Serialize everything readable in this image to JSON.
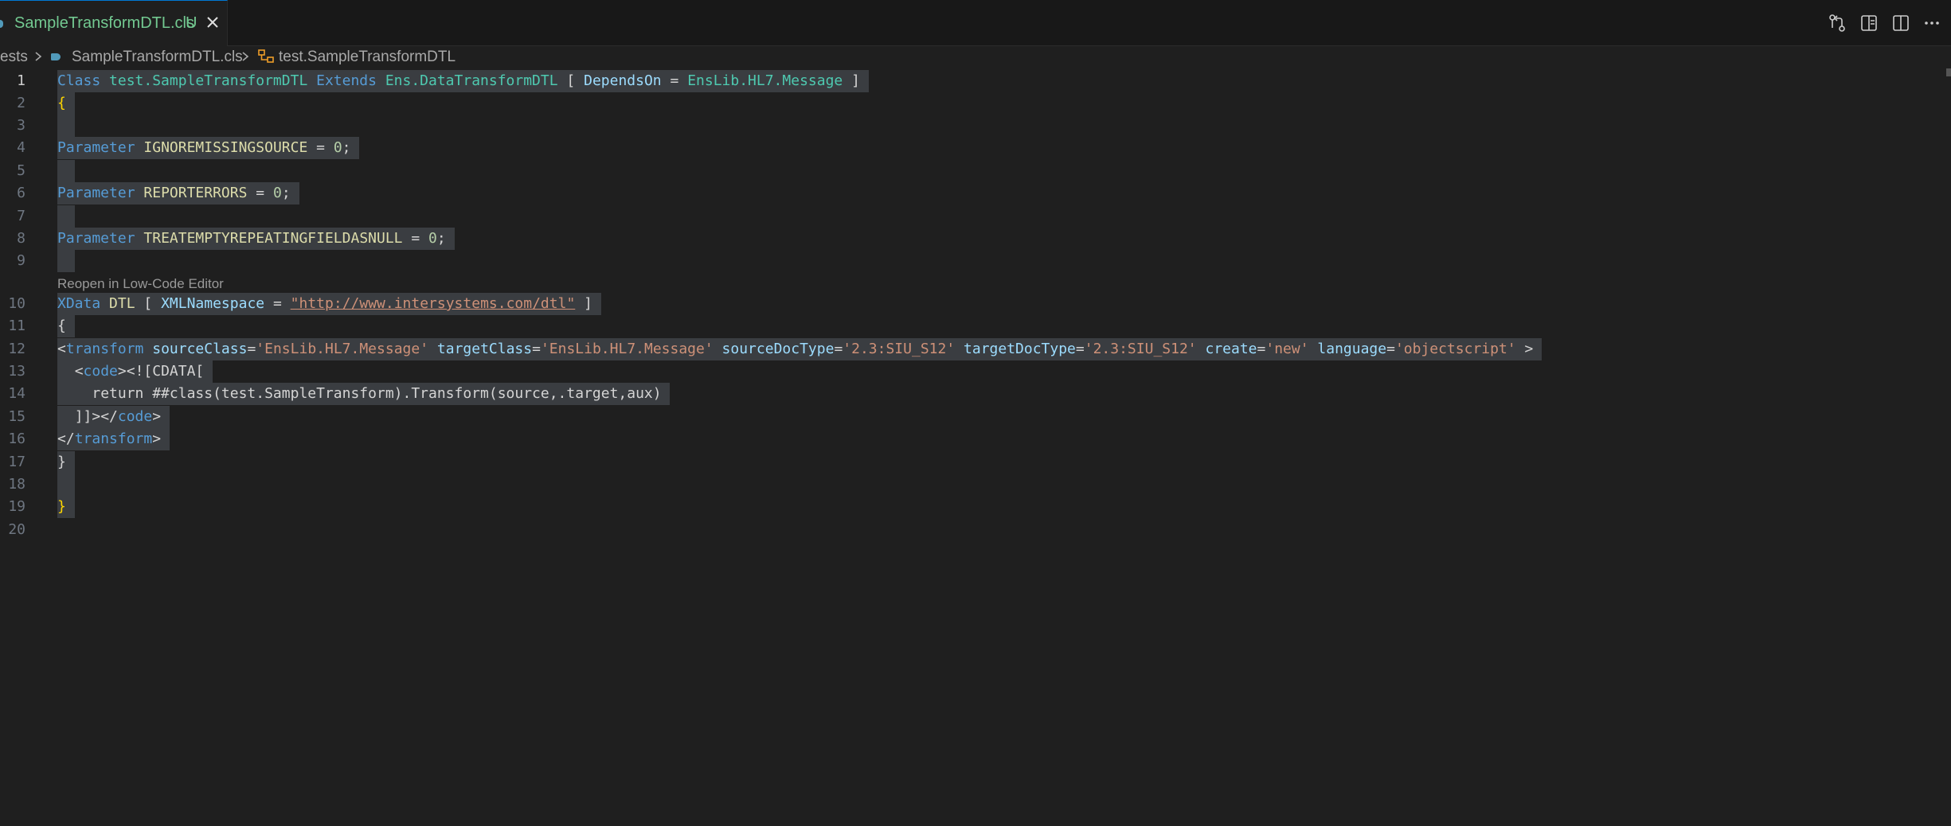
{
  "tab": {
    "filename": "SampleTransformDTL.cls",
    "status": "U"
  },
  "breadcrumb": {
    "folder": "ests",
    "file": "SampleTransformDTL.cls",
    "symbol": "test.SampleTransformDTL"
  },
  "codelens": "Reopen in Low-Code Editor",
  "line_numbers": [
    "1",
    "2",
    "3",
    "4",
    "5",
    "6",
    "7",
    "8",
    "9",
    "10",
    "11",
    "12",
    "13",
    "14",
    "15",
    "16",
    "17",
    "18",
    "19",
    "20"
  ],
  "code": {
    "l1": {
      "kw_class": "Class",
      "name": "test.SampleTransformDTL",
      "kw_extends": "Extends",
      "super": "Ens.DataTransformDTL",
      "lb": "[",
      "kw_depends": "DependsOn",
      "eq": "=",
      "dep": "EnsLib.HL7.Message",
      "rb": "]"
    },
    "l2": "{",
    "l4": {
      "kw": "Parameter",
      "name": "IGNOREMISSINGSOURCE",
      "eq": "=",
      "val": "0",
      "semi": ";"
    },
    "l6": {
      "kw": "Parameter",
      "name": "REPORTERRORS",
      "eq": "=",
      "val": "0",
      "semi": ";"
    },
    "l8": {
      "kw": "Parameter",
      "name": "TREATEMPTYREPEATINGFIELDASNULL",
      "eq": "=",
      "val": "0",
      "semi": ";"
    },
    "l10": {
      "kw": "XData",
      "name": "DTL",
      "lb": "[",
      "attr": "XMLNamespace",
      "eq": "=",
      "val": "\"http://www.intersystems.com/dtl\"",
      "rb": "]"
    },
    "l11": "{",
    "l12": {
      "lt": "<",
      "tag": "transform",
      "a1": "sourceClass",
      "v1": "'EnsLib.HL7.Message'",
      "a2": "targetClass",
      "v2": "'EnsLib.HL7.Message'",
      "a3": "sourceDocType",
      "v3": "'2.3:SIU_S12'",
      "a4": "targetDocType",
      "v4": "'2.3:SIU_S12'",
      "a5": "create",
      "v5": "'new'",
      "a6": "language",
      "v6": "'objectscript'",
      "gt": ">"
    },
    "l13": {
      "open": "<",
      "tag": "code",
      "rest": "><![CDATA["
    },
    "l14": "return ##class(test.SampleTransform).Transform(source,.target,aux)",
    "l15": {
      "pre": "]]></",
      "tag": "code",
      "post": ">"
    },
    "l16": {
      "pre": "</",
      "tag": "transform",
      "post": ">"
    },
    "l17": "}",
    "l19": "}"
  },
  "colors": {
    "accent": "#0078d4",
    "modified": "#73c991",
    "keyword": "#569cd6",
    "class": "#4ec9b0",
    "string": "#ce9178",
    "brace": "#ffd700"
  }
}
